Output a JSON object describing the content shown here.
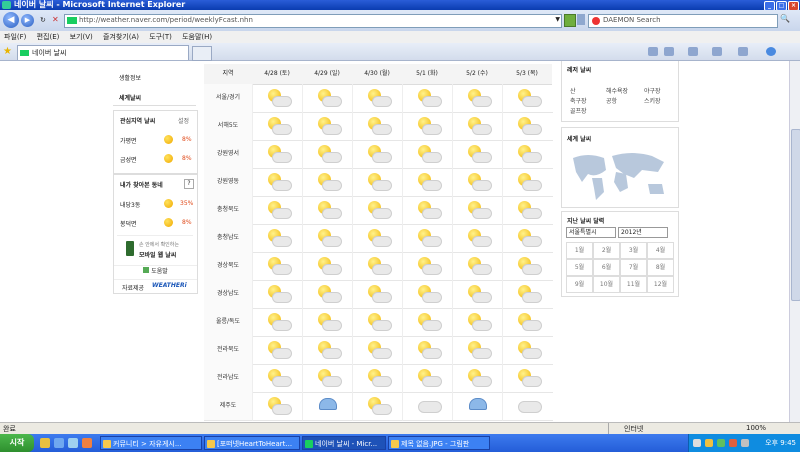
{
  "window": {
    "title": "네이버 날씨 - Microsoft Internet Explorer"
  },
  "address": {
    "url": "http://weather.naver.com/period/weeklyFcast.nhn",
    "search_placeholder": "DAEMON Search"
  },
  "menu": [
    "파일(F)",
    "편집(E)",
    "보기(V)",
    "즐겨찾기(A)",
    "도구(T)",
    "도움말(H)"
  ],
  "tab": {
    "label": "네이버 날씨"
  },
  "left": {
    "links": [
      "생활정보",
      "세계날씨"
    ],
    "interest": {
      "title": "관심지역 날씨",
      "setting": "설정",
      "items": [
        {
          "name": "가평면",
          "pct": "8%"
        },
        {
          "name": "금성면",
          "pct": "8%"
        }
      ]
    },
    "recent": {
      "title": "내가 찾아본 동네",
      "help": "?",
      "items": [
        {
          "name": "내당3동",
          "pct": "35%"
        },
        {
          "name": "봉덕면",
          "pct": "8%"
        }
      ]
    },
    "mobile": {
      "line1": "손 안에서 확인하는",
      "line2": "모바일 웹 날씨"
    },
    "help": "도움말",
    "source_label": "자료제공",
    "source_logo": "WEATHERi"
  },
  "table": {
    "headers": [
      "지역",
      "4/28 (토)",
      "4/29 (일)",
      "4/30 (월)",
      "5/1 (화)",
      "5/2 (수)",
      "5/3 (목)"
    ],
    "regions": [
      "서울/경기",
      "서해5도",
      "강원영서",
      "강원영동",
      "충청북도",
      "충청남도",
      "경상북도",
      "경상남도",
      "울릉/독도",
      "전라북도",
      "전라남도",
      "제주도"
    ],
    "icons": [
      [
        "sunny-cloud",
        "sunny-cloud",
        "sunny-cloud",
        "sunny-cloud",
        "sunny-cloud",
        "sunny-cloud"
      ],
      [
        "sunny-cloud",
        "sunny-cloud",
        "sunny-cloud",
        "sunny-cloud",
        "sunny-cloud",
        "sunny-cloud"
      ],
      [
        "sunny-cloud",
        "sunny-cloud",
        "sunny-cloud",
        "sunny-cloud",
        "sunny-cloud",
        "sunny-cloud"
      ],
      [
        "sunny-cloud",
        "sunny-cloud",
        "sunny-cloud",
        "sunny-cloud",
        "sunny-cloud",
        "sunny-cloud"
      ],
      [
        "sunny-cloud",
        "sunny-cloud",
        "sunny-cloud",
        "sunny-cloud",
        "sunny-cloud",
        "sunny-cloud"
      ],
      [
        "sunny-cloud",
        "sunny-cloud",
        "sunny-cloud",
        "sunny-cloud",
        "sunny-cloud",
        "sunny-cloud"
      ],
      [
        "sunny-cloud",
        "sunny-cloud",
        "sunny-cloud",
        "sunny-cloud",
        "sunny-cloud",
        "sunny-cloud"
      ],
      [
        "sunny-cloud",
        "sunny-cloud",
        "sunny-cloud",
        "sunny-cloud",
        "sunny-cloud",
        "sunny-cloud"
      ],
      [
        "sunny-cloud",
        "sunny-cloud",
        "sunny-cloud",
        "sunny-cloud",
        "sunny-cloud",
        "sunny-cloud"
      ],
      [
        "sunny-cloud",
        "sunny-cloud",
        "sunny-cloud",
        "sunny-cloud",
        "sunny-cloud",
        "sunny-cloud"
      ],
      [
        "sunny-cloud",
        "sunny-cloud",
        "sunny-cloud",
        "sunny-cloud",
        "sunny-cloud",
        "sunny-cloud"
      ],
      [
        "sunny-cloud",
        "rain",
        "sunny-cloud",
        "cloud",
        "rain",
        "cloud"
      ]
    ]
  },
  "right": {
    "leisure": {
      "title": "레저 날씨",
      "items": [
        "산",
        "해수욕장",
        "야구장",
        "축구장",
        "공항",
        "스키장",
        "골프장"
      ]
    },
    "world": {
      "title": "세계 날씨"
    },
    "history": {
      "title": "지난 날씨 달력",
      "region": "서울특별시",
      "year": "2012년",
      "months": [
        "1월",
        "2월",
        "3월",
        "4월",
        "5월",
        "6월",
        "7월",
        "8월",
        "9월",
        "10월",
        "11월",
        "12월"
      ]
    }
  },
  "status": {
    "left": "완료",
    "zone": "인터넷",
    "zoom": "100%"
  },
  "taskbar": {
    "start": "시작",
    "tasks": [
      "커뮤니티 > 자유게시...",
      "[포떠넷HeartToHeart...",
      "네이버 날씨 - Micr...",
      "제목 없음.JPG - 그림판"
    ],
    "clock": "오후 9:45"
  },
  "colors": {
    "titlebar": "#0a3cb0",
    "taskbar": "#245dd8",
    "naver_green": "#19ce60",
    "percent": "#e04a1a"
  }
}
